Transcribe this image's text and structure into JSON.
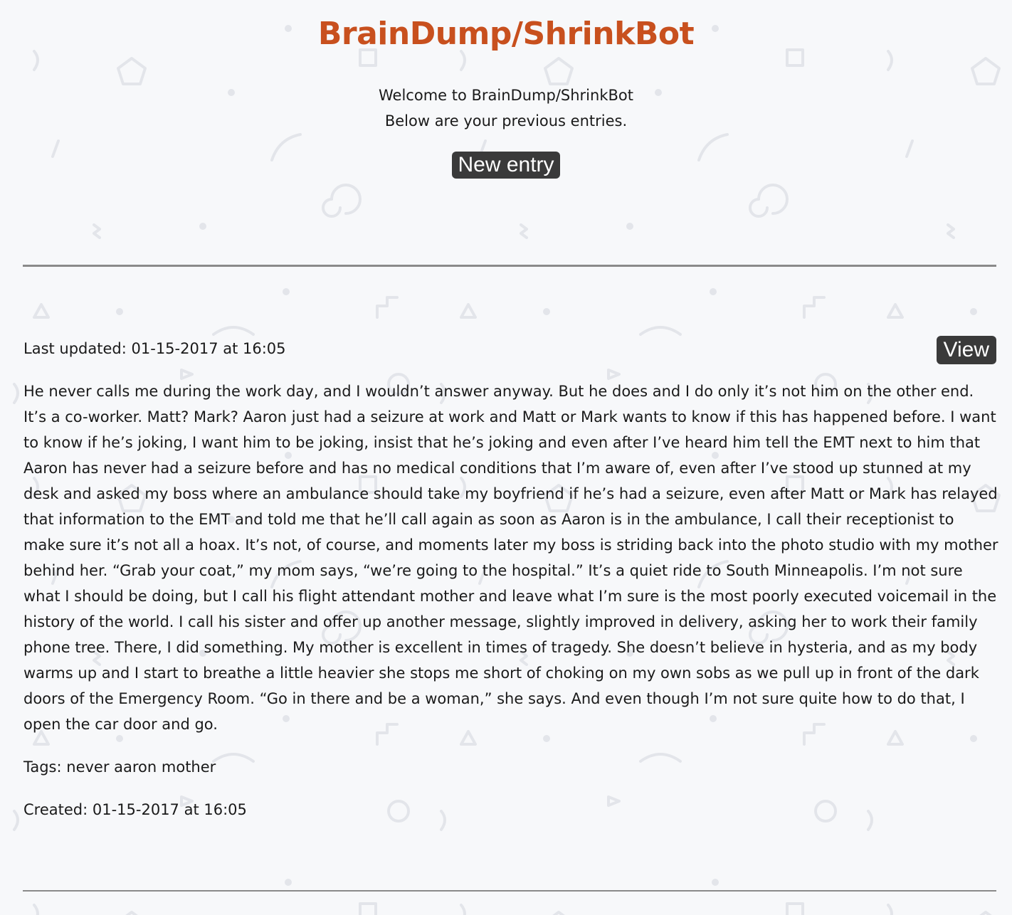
{
  "header": {
    "title": "BrainDump/ShrinkBot",
    "welcome_line": "Welcome to BrainDump/ShrinkBot",
    "subtitle_line": "Below are your previous entries.",
    "new_entry_label": "New entry"
  },
  "entries": [
    {
      "last_updated_label": "Last updated:",
      "last_updated": "01-15-2017 at 16:05",
      "view_label": "View",
      "body": "He never calls me during the work day, and I wouldn’t answer anyway. But he does and I do only it’s not him on the other end. It’s a co-worker. Matt? Mark? Aaron just had a seizure at work and Matt or Mark wants to know if this has happened before. I want to know if he’s joking, I want him to be joking, insist that he’s joking and even after I’ve heard him tell the EMT next to him that Aaron has never had a seizure before and has no medical conditions that I’m aware of, even after I’ve stood up stunned at my desk and asked my boss where an ambulance should take my boyfriend if he’s had a seizure, even after Matt or Mark has relayed that information to the EMT and told me that he’ll call again as soon as Aaron is in the ambulance, I call their receptionist to make sure it’s not all a hoax. It’s not, of course, and moments later my boss is striding back into the photo studio with my mother behind her. “Grab your coat,” my mom says, “we’re going to the hospital.” It’s a quiet ride to South Minneapolis. I’m not sure what I should be doing, but I call his flight attendant mother and leave what I’m sure is the most poorly executed voicemail in the history of the world. I call his sister and offer up another message, slightly improved in delivery, asking her to work their family phone tree. There, I did something. My mother is excellent in times of tragedy. She doesn’t believe in hysteria, and as my body warms up and I start to breathe a little heavier she stops me short of choking on my own sobs as we pull up in front of the dark doors of the Emergency Room. “Go in there and be a woman,” she says. And even though I’m not sure quite how to do that, I open the car door and go.",
      "tags_label": "Tags:",
      "tags": "never aaron mother",
      "created_label": "Created:",
      "created": "01-15-2017 at 16:05"
    }
  ],
  "colors": {
    "title": "#c8501e",
    "background": "#f7f8fa",
    "button": "#3a3a3a",
    "pattern": "#e3e5ea",
    "divider": "#8a8a8a"
  }
}
